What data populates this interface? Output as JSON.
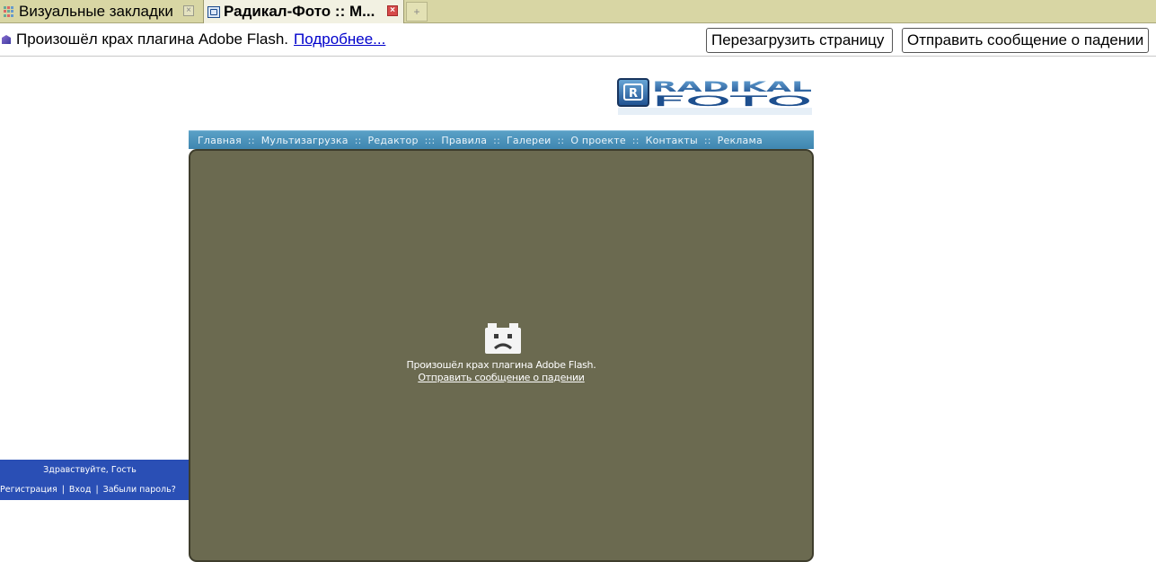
{
  "tabs": [
    {
      "title": "Визуальные закладки",
      "close": "×"
    },
    {
      "title": "Радикал-Фото :: М...",
      "close": "×"
    }
  ],
  "new_tab": "+",
  "infobar": {
    "message": "Произошёл крах плагина Adobe Flash.",
    "details_link": "Подробнее...",
    "reload_button": "Перезагрузить страницу",
    "report_button": "Отправить сообщение о падении"
  },
  "site": {
    "logo_top": "RADIKAL",
    "logo_bottom": "FOTO",
    "logo_mark": "R",
    "nav": [
      "Главная",
      "Мультизагрузка",
      "Редактор",
      "Правила",
      "Галереи",
      "О проекте",
      "Контакты",
      "Реклама"
    ],
    "nav_separators": [
      "::",
      "::",
      ":::",
      "::",
      "::",
      "::",
      "::"
    ],
    "plugin_crash": {
      "message": "Произошёл крах плагина Adobe Flash.",
      "report_link": "Отправить сообщение о падении"
    },
    "login": {
      "greeting": "Здравствуйте, Гость",
      "register": "Регистрация",
      "login": "Вход",
      "forgot": "Забыли пароль?",
      "separator": "|"
    }
  },
  "colors": {
    "tabbar": "#d8d6a4",
    "nav_bar": "#4a90bb",
    "flash_area": "#6b6a50",
    "login_box": "#2a4fb5",
    "link": "#0000cc"
  }
}
